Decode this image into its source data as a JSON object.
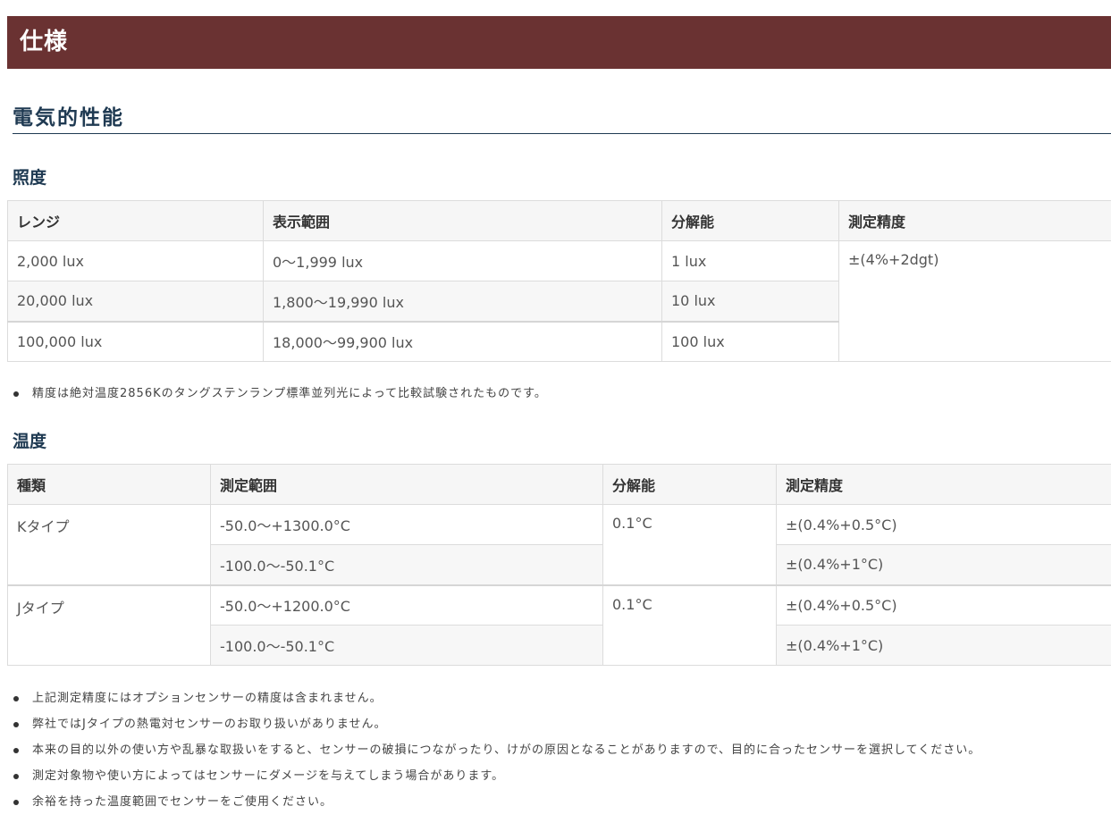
{
  "banner": {
    "title": "仕様"
  },
  "section": {
    "title": "電気的性能"
  },
  "illuminance": {
    "title": "照度",
    "headers": [
      "レンジ",
      "表示範囲",
      "分解能",
      "測定精度"
    ],
    "rows": [
      {
        "range": "2,000 lux",
        "display": "0～1,999 lux",
        "resolution": "1 lux"
      },
      {
        "range": "20,000 lux",
        "display": "1,800～19,990 lux",
        "resolution": "10 lux"
      },
      {
        "range": "100,000 lux",
        "display": "18,000～99,900 lux",
        "resolution": "100 lux"
      }
    ],
    "accuracy": "±(4%+2dgt)",
    "note": "精度は絶対温度2856Kのタングステンランプ標準並列光によって比較試験されたものです。"
  },
  "temperature": {
    "title": "温度",
    "headers": [
      "種類",
      "測定範囲",
      "分解能",
      "測定精度"
    ],
    "groups": [
      {
        "type": "Kタイプ",
        "resolution": "0.1°C",
        "rows": [
          {
            "range": "-50.0～+1300.0°C",
            "accuracy": "±(0.4%+0.5°C)"
          },
          {
            "range": "-100.0～-50.1°C",
            "accuracy": "±(0.4%+1°C)"
          }
        ]
      },
      {
        "type": "Jタイプ",
        "resolution": "0.1°C",
        "rows": [
          {
            "range": "-50.0～+1200.0°C",
            "accuracy": "±(0.4%+0.5°C)"
          },
          {
            "range": "-100.0～-50.1°C",
            "accuracy": "±(0.4%+1°C)"
          }
        ]
      }
    ],
    "notes": [
      "上記測定精度にはオプションセンサーの精度は含まれません。",
      "弊社ではJタイプの熱電対センサーのお取り扱いがありません。",
      "本来の目的以外の使い方や乱暴な取扱いをすると、センサーの破損につながったり、けがの原因となることがありますので、目的に合ったセンサーを選択してください。",
      "測定対象物や使い方によってはセンサーにダメージを与えてしまう場合があります。",
      "余裕を持った温度範囲でセンサーをご使用ください。"
    ]
  }
}
